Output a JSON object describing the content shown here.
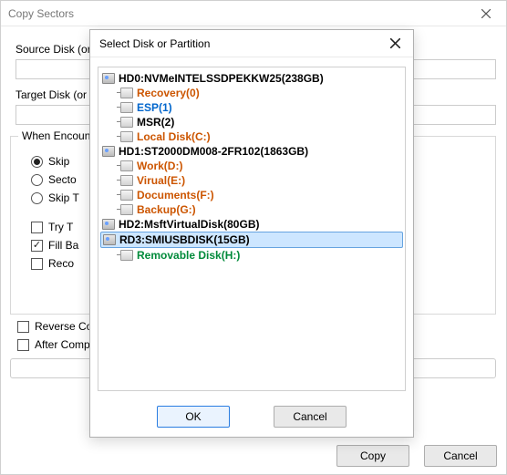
{
  "outer": {
    "title": "Copy Sectors",
    "source_label": "Source Disk (or",
    "target_label": "Target Disk (or",
    "group_title": "When Encoun",
    "radios": {
      "skip": "Skip",
      "sector": "Secto",
      "skip_t": "Skip T"
    },
    "checks": {
      "try": "Try T",
      "fill": "Fill Ba",
      "reco": "Reco",
      "reverse": "Reverse Co",
      "after": "After Comp"
    },
    "buttons": {
      "copy": "Copy",
      "cancel": "Cancel"
    }
  },
  "inner": {
    "title": "Select Disk or Partition",
    "disks": [
      {
        "label": "HD0:NVMeINTELSSDPEKKW25(238GB)",
        "partitions": [
          {
            "label": "Recovery(0)",
            "cls": "link-orange"
          },
          {
            "label": "ESP(1)",
            "cls": "link-blue"
          },
          {
            "label": "MSR(2)",
            "cls": ""
          },
          {
            "label": "Local Disk(C:)",
            "cls": "link-orange"
          }
        ]
      },
      {
        "label": "HD1:ST2000DM008-2FR102(1863GB)",
        "partitions": [
          {
            "label": "Work(D:)",
            "cls": "link-orange"
          },
          {
            "label": "Virual(E:)",
            "cls": "link-orange"
          },
          {
            "label": "Documents(F:)",
            "cls": "link-orange"
          },
          {
            "label": "Backup(G:)",
            "cls": "link-orange"
          }
        ]
      },
      {
        "label": "HD2:MsftVirtualDisk(80GB)",
        "partitions": []
      },
      {
        "label": "RD3:SMIUSBDISK(15GB)",
        "selected": true,
        "partitions": [
          {
            "label": "Removable Disk(H:)",
            "cls": "link-green"
          }
        ]
      }
    ],
    "buttons": {
      "ok": "OK",
      "cancel": "Cancel"
    }
  }
}
